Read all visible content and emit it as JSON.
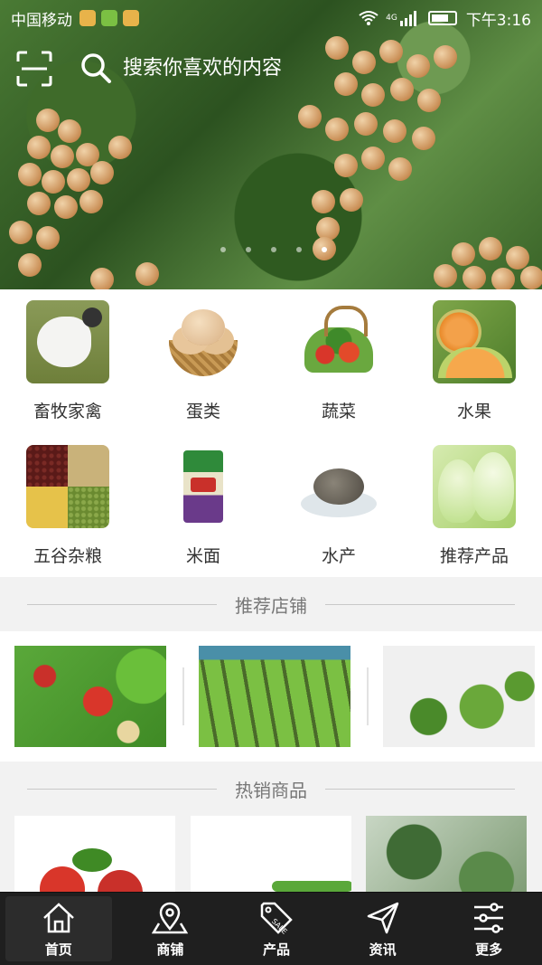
{
  "status_bar": {
    "carrier": "中国移动",
    "network": "4G",
    "time": "下午3:16"
  },
  "search": {
    "placeholder": "搜索你喜欢的内容"
  },
  "banner": {
    "dots_count": 5,
    "active_dot": 0
  },
  "categories": [
    {
      "label": "畜牧家禽",
      "icon": "poultry"
    },
    {
      "label": "蛋类",
      "icon": "eggs"
    },
    {
      "label": "蔬菜",
      "icon": "vegetables"
    },
    {
      "label": "水果",
      "icon": "fruit"
    },
    {
      "label": "五谷杂粮",
      "icon": "grains"
    },
    {
      "label": "米面",
      "icon": "rice"
    },
    {
      "label": "水产",
      "icon": "aquatic"
    },
    {
      "label": "推荐产品",
      "icon": "recommended"
    }
  ],
  "sections": {
    "stores_title": "推荐店铺",
    "hot_title": "热销商品"
  },
  "tabbar": [
    {
      "label": "首页",
      "icon": "home-icon",
      "active": true
    },
    {
      "label": "商铺",
      "icon": "map-pin-icon",
      "active": false
    },
    {
      "label": "产品",
      "icon": "sale-tag-icon",
      "active": false
    },
    {
      "label": "资讯",
      "icon": "send-icon",
      "active": false
    },
    {
      "label": "更多",
      "icon": "sliders-icon",
      "active": false
    }
  ],
  "colors": {
    "tabbar_bg": "#1f1f1f",
    "section_text": "#777777",
    "page_bg": "#f2f2f2"
  }
}
